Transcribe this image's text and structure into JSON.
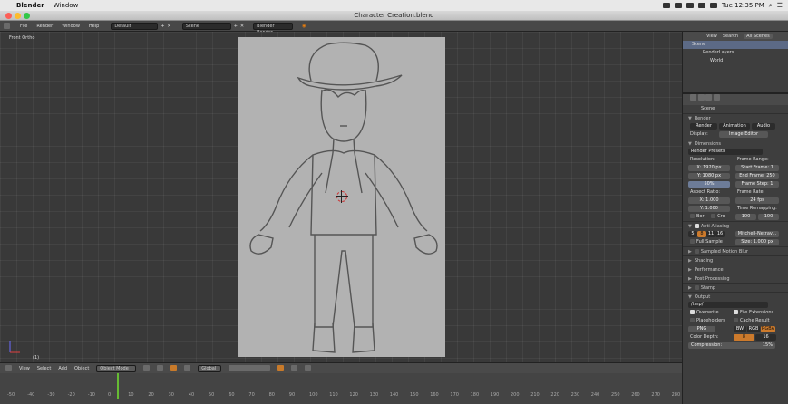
{
  "macbar": {
    "apple": "",
    "app": "Blender",
    "menus": [
      "Window"
    ],
    "clock": "Tue 12:35 PM"
  },
  "window": {
    "title": "Character Creation.blend"
  },
  "info": {
    "menus": [
      "File",
      "Render",
      "Window",
      "Help"
    ],
    "layout": "Default",
    "scene": "Scene",
    "engine": "Blender Render"
  },
  "viewport": {
    "label": "Front Ortho",
    "frame_label": "(1)"
  },
  "vpheader": {
    "menus": [
      "View",
      "Select",
      "Add",
      "Object"
    ],
    "mode": "Object Mode",
    "orientation": "Global"
  },
  "timeline": {
    "ticks": [
      "-50",
      "-40",
      "-30",
      "-20",
      "-10",
      "0",
      "10",
      "20",
      "30",
      "40",
      "50",
      "60",
      "70",
      "80",
      "90",
      "100",
      "110",
      "120",
      "130",
      "140",
      "150",
      "160",
      "170",
      "180",
      "190",
      "200",
      "210",
      "220",
      "230",
      "240",
      "250",
      "260",
      "270",
      "280"
    ]
  },
  "outliner": {
    "tabs": [
      "View",
      "Search",
      "All Scenes"
    ],
    "rows": [
      "Scene",
      "RenderLayers",
      "World"
    ]
  },
  "props": {
    "scene_label": "Scene",
    "sections": {
      "render": "Render",
      "dimensions": "Dimensions",
      "antialias": "Anti-Aliasing",
      "motion_blur": "Sampled Motion Blur",
      "shading": "Shading",
      "performance": "Performance",
      "post": "Post Processing",
      "stamp": "Stamp",
      "output": "Output"
    },
    "render_buttons": [
      "Render",
      "Animation",
      "Audio"
    ],
    "display_label": "Display:",
    "display_value": "Image Editor",
    "render_presets": "Render Presets",
    "resolution_label": "Resolution:",
    "res_x": "X: 1920 px",
    "res_y": "Y: 1080 px",
    "res_pct": "50%",
    "frame_range_label": "Frame Range:",
    "start_frame": "Start Frame: 1",
    "end_frame": "End Frame: 250",
    "frame_step": "Frame Step: 1",
    "aspect_label": "Aspect Ratio:",
    "aspect_x": "X: 1.000",
    "aspect_y": "Y: 1.000",
    "frame_rate_label": "Frame Rate:",
    "frame_rate": "24 fps",
    "time_remap_label": "Time Remapping:",
    "remap_old": "100",
    "remap_new": "100",
    "border": "Bor",
    "crop": "Cro",
    "aa_samples": [
      "5",
      "8",
      "11",
      "16"
    ],
    "aa_filter": "Mitchell-Netrav...",
    "full_sample": "Full Sample",
    "aa_size": "Size: 1.000 px",
    "output_path": "/tmp/",
    "overwrite": "Overwrite",
    "file_ext": "File Extensions",
    "placeholders": "Placeholders",
    "cache_result": "Cache Result",
    "format": "PNG",
    "color_modes": [
      "BW",
      "RGB",
      "RGBA"
    ],
    "color_depth_label": "Color Depth:",
    "color_depth_8": "8",
    "color_depth_16": "16",
    "compression": "Compression:",
    "compression_value": "15%"
  }
}
